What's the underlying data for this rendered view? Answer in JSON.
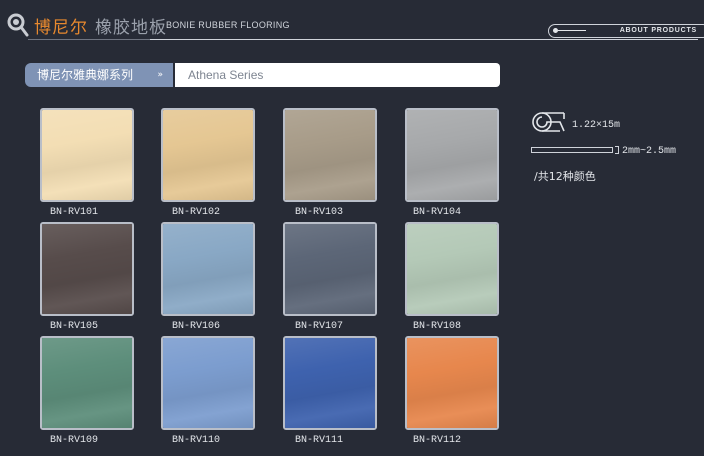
{
  "header": {
    "brand_cn": "博尼尔",
    "brand_sub": "橡胶地板",
    "brand_en": "BONIE RUBBER FLOORING",
    "about_label": "ABOUT PRODUCTS"
  },
  "series": {
    "tab_label": "博尼尔雅典娜系列",
    "tab_arrow": "»",
    "name": "Athena Series"
  },
  "swatches": [
    {
      "code": "BN-RV101",
      "color": "#f3deb4"
    },
    {
      "code": "BN-RV102",
      "color": "#e5c793"
    },
    {
      "code": "BN-RV103",
      "color": "#a89c89"
    },
    {
      "code": "BN-RV104",
      "color": "#a7a9ab"
    },
    {
      "code": "BN-RV105",
      "color": "#574c4b"
    },
    {
      "code": "BN-RV106",
      "color": "#89a8c5"
    },
    {
      "code": "BN-RV107",
      "color": "#5c6677"
    },
    {
      "code": "BN-RV108",
      "color": "#b4c9b7"
    },
    {
      "code": "BN-RV109",
      "color": "#5d8e7b"
    },
    {
      "code": "BN-RV110",
      "color": "#7c9dcf"
    },
    {
      "code": "BN-RV111",
      "color": "#3e62ae"
    },
    {
      "code": "BN-RV112",
      "color": "#e7874d"
    }
  ],
  "specs": {
    "roll_size": "1.22×15m",
    "thickness": "2mm~2.5mm",
    "color_count": "/共12种颜色"
  }
}
